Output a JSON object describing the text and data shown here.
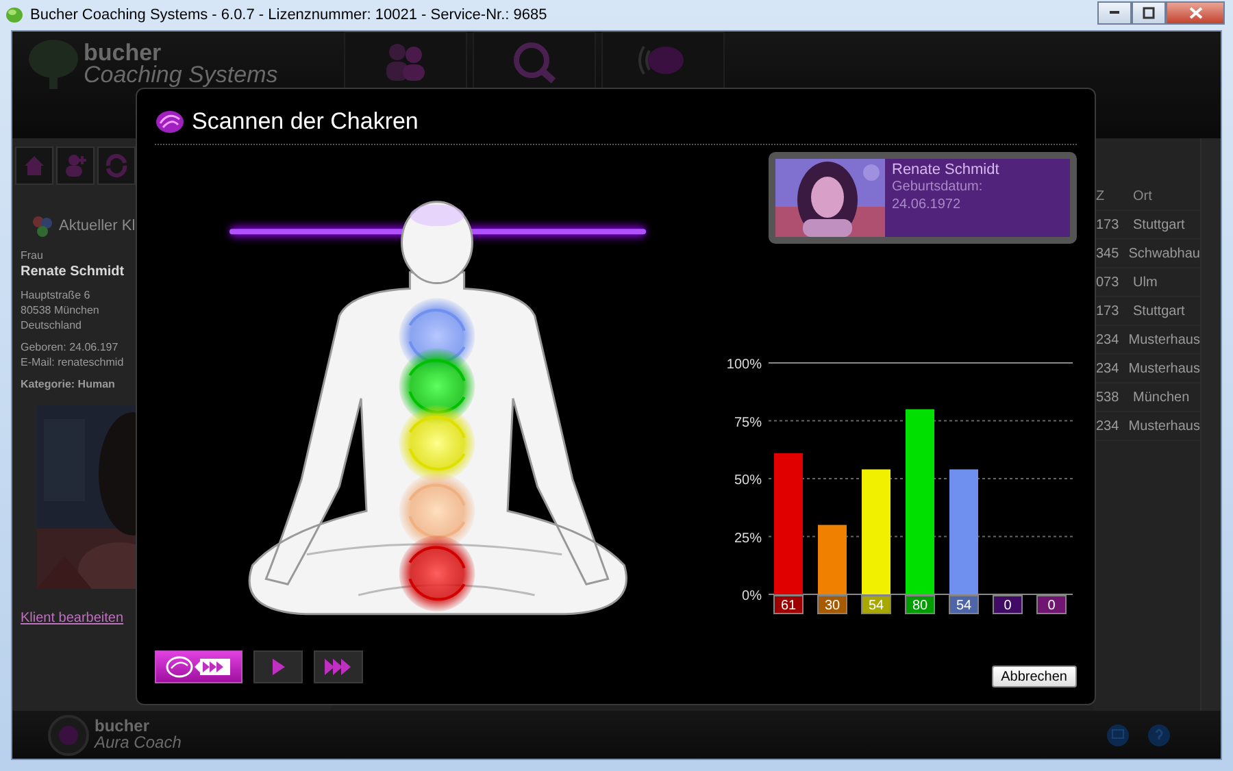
{
  "window": {
    "title": "Bucher Coaching Systems - 6.0.7 - Lizenznummer: 10021 - Service-Nr.: 9685"
  },
  "header": {
    "logo_line1": "bucher",
    "logo_line2": "Coaching Systems"
  },
  "client_panel": {
    "heading": "Aktueller Kl",
    "salutation": "Frau",
    "name": "Renate Schmidt",
    "address": [
      "Hauptstraße 6",
      "80538 München",
      "Deutschland"
    ],
    "born": "Geboren: 24.06.197",
    "email": "E-Mail: renateschmid",
    "category": "Kategorie: Human",
    "edit_link": "Klient bearbeiten"
  },
  "client_table": {
    "columns": [
      "Z",
      "Ort"
    ],
    "rows": [
      [
        "173",
        "Stuttgart"
      ],
      [
        "345",
        "Schwabhau"
      ],
      [
        "073",
        "Ulm"
      ],
      [
        "173",
        "Stuttgart"
      ],
      [
        "234",
        "Musterhaus"
      ],
      [
        "234",
        "Musterhaus"
      ],
      [
        "538",
        "München"
      ],
      [
        "234",
        "Musterhaus"
      ]
    ]
  },
  "dialog": {
    "title": "Scannen der Chakren",
    "client_card": {
      "name": "Renate Schmidt",
      "birth_label": "Geburtsdatum:",
      "birth_date": "24.06.1972"
    },
    "chart_data": {
      "type": "bar",
      "values": [
        61,
        30,
        54,
        80,
        54,
        0,
        0
      ],
      "colors": [
        "#e00000",
        "#f08000",
        "#f0f000",
        "#00e000",
        "#7090f0",
        "#5a1090",
        "#a020a0"
      ],
      "ylim": [
        0,
        100
      ],
      "yticks": [
        {
          "value": 0,
          "label": "0%"
        },
        {
          "value": 25,
          "label": "25%"
        },
        {
          "value": 50,
          "label": "50%"
        },
        {
          "value": 75,
          "label": "75%"
        },
        {
          "value": 100,
          "label": "100%"
        }
      ],
      "grid": true,
      "data_labels": true
    },
    "buttons": [
      {
        "kind": "scan",
        "selected": true
      },
      {
        "kind": "play",
        "selected": false
      },
      {
        "kind": "fast_forward",
        "selected": false
      }
    ],
    "cancel_button": "Abbrechen"
  },
  "status_bar": {
    "logo_line1": "bucher",
    "logo_line2": "Aura Coach"
  }
}
